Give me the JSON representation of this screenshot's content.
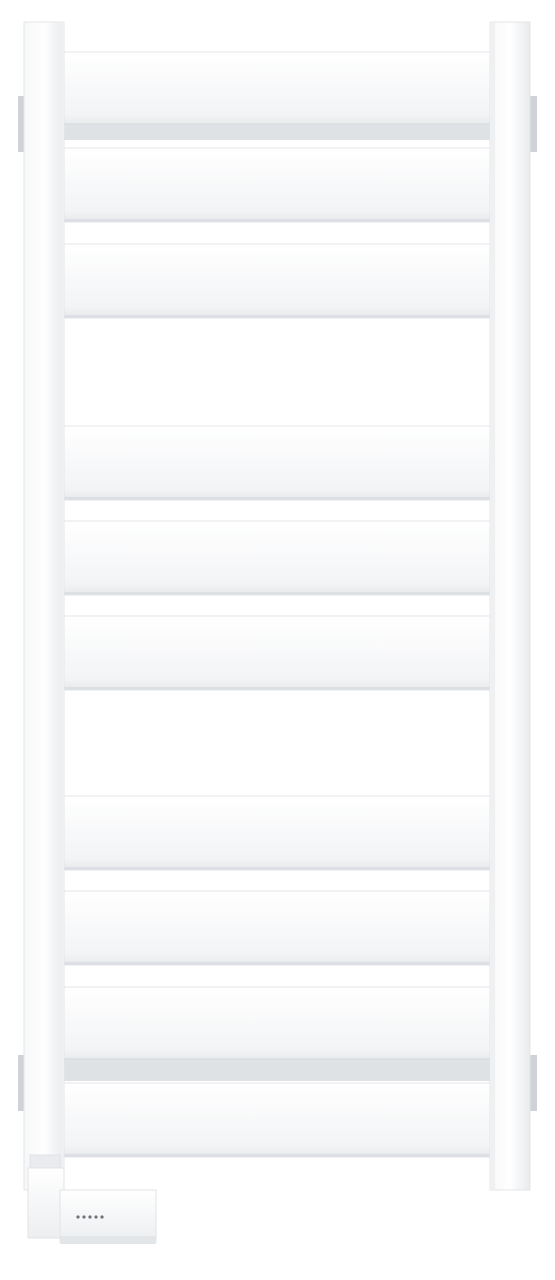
{
  "product": {
    "kind": "towel-radiator",
    "finish_color": "#ffffff",
    "panel_count": 10,
    "control_unit_indicator_dots": 5
  },
  "colors": {
    "background": "#ffffff",
    "frame_shade": "#eceef0",
    "panel_shade": "#f1f3f5",
    "gap_shadow": "#dadde1",
    "bracket": "#c9ccd1",
    "indicator": "#6f737a"
  }
}
